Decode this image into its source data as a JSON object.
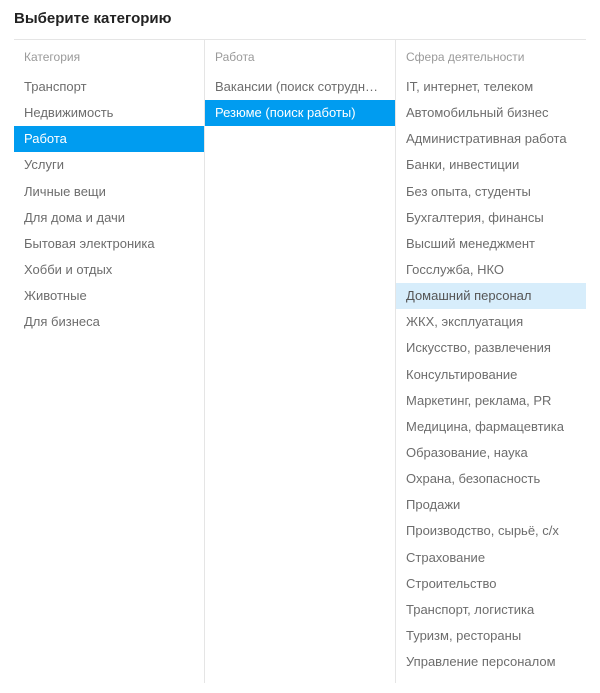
{
  "title": "Выберите категорию",
  "columns": [
    {
      "header": "Категория",
      "items": [
        {
          "label": "Транспорт",
          "state": ""
        },
        {
          "label": "Недвижимость",
          "state": ""
        },
        {
          "label": "Работа",
          "state": "selected"
        },
        {
          "label": "Услуги",
          "state": ""
        },
        {
          "label": "Личные вещи",
          "state": ""
        },
        {
          "label": "Для дома и дачи",
          "state": ""
        },
        {
          "label": "Бытовая электроника",
          "state": ""
        },
        {
          "label": "Хобби и отдых",
          "state": ""
        },
        {
          "label": "Животные",
          "state": ""
        },
        {
          "label": "Для бизнеса",
          "state": ""
        }
      ]
    },
    {
      "header": "Работа",
      "items": [
        {
          "label": "Вакансии (поиск сотрудников)",
          "state": ""
        },
        {
          "label": "Резюме (поиск работы)",
          "state": "selected"
        }
      ]
    },
    {
      "header": "Сфера деятельности",
      "items": [
        {
          "label": "IT, интернет, телеком",
          "state": ""
        },
        {
          "label": "Автомобильный бизнес",
          "state": ""
        },
        {
          "label": "Административная работа",
          "state": ""
        },
        {
          "label": "Банки, инвестиции",
          "state": ""
        },
        {
          "label": "Без опыта, студенты",
          "state": ""
        },
        {
          "label": "Бухгалтерия, финансы",
          "state": ""
        },
        {
          "label": "Высший менеджмент",
          "state": ""
        },
        {
          "label": "Госслужба, НКО",
          "state": ""
        },
        {
          "label": "Домашний персонал",
          "state": "hovered"
        },
        {
          "label": "ЖКХ, эксплуатация",
          "state": ""
        },
        {
          "label": "Искусство, развлечения",
          "state": ""
        },
        {
          "label": "Консультирование",
          "state": ""
        },
        {
          "label": "Маркетинг, реклама, PR",
          "state": ""
        },
        {
          "label": "Медицина, фармацевтика",
          "state": ""
        },
        {
          "label": "Образование, наука",
          "state": ""
        },
        {
          "label": "Охрана, безопасность",
          "state": ""
        },
        {
          "label": "Продажи",
          "state": ""
        },
        {
          "label": "Производство, сырьё, с/х",
          "state": ""
        },
        {
          "label": "Страхование",
          "state": ""
        },
        {
          "label": "Строительство",
          "state": ""
        },
        {
          "label": "Транспорт, логистика",
          "state": ""
        },
        {
          "label": "Туризм, рестораны",
          "state": ""
        },
        {
          "label": "Управление персоналом",
          "state": ""
        }
      ]
    }
  ]
}
